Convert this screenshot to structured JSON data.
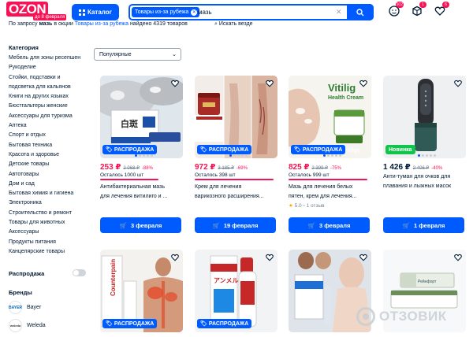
{
  "header": {
    "logo_text": "OZON",
    "logo_sub": "до 8 февраля",
    "catalog_label": "Каталог",
    "search_chip": "Товары из-за рубежа",
    "search_value": "мазь",
    "badges": {
      "messages": "102",
      "orders": "1",
      "favorites": "6"
    }
  },
  "results": {
    "prefix": "По запросу",
    "query": "мазь",
    "middle": "в окции",
    "scope": "Товары из-за рубежа",
    "suffix": "найдено 4319 товаров",
    "save_label": "Искать везде"
  },
  "sidebar": {
    "category_title": "Категория",
    "categories": [
      "Мебель для зоны ресепшен",
      "Рукоделие",
      "Стойки, подставки и",
      "подсветка для кальянов",
      "Книги на других языках",
      "Бюстгальтеры женские",
      "Аксессуары для туризма",
      "Аптека",
      "Спорт и отдых",
      "Бытовая техника",
      "Красота и здоровье",
      "Детские товары",
      "Автотовары",
      "Дом и сад",
      "Бытовая химия и гигиена",
      "Электроника",
      "Строительство и ремонт",
      "Товары для животных",
      "Аксессуары",
      "Продукты питания",
      "Канцелярские товары"
    ],
    "sale_label": "Распродажа",
    "brands_title": "Бренды",
    "brands": [
      {
        "name": "Bayer",
        "logo": "BAYER"
      },
      {
        "name": "Weleda",
        "logo": "weleda"
      }
    ]
  },
  "sort": {
    "selected": "Популярные"
  },
  "products": [
    {
      "tag": "РАСПРОДАЖА",
      "tag_type": "sale",
      "price": "253 ₽",
      "old": "2 068 ₽",
      "disc": "-88%",
      "left": "Осталось 1000 шт",
      "title1": "Антибактериальная мазь",
      "title2": "для лечения витилиго и ...",
      "rating": "",
      "reviews": "",
      "delivery": "3 февраля",
      "price_black": false
    },
    {
      "tag": "РАСПРОДАЖА",
      "tag_type": "sale",
      "price": "972 ₽",
      "old": "3 185 ₽",
      "disc": "-69%",
      "left": "Осталось 398 шт",
      "title1": "Крем для лечения",
      "title2": "варикозного расширения...",
      "rating": "",
      "reviews": "",
      "delivery": "19 февраля",
      "price_black": false
    },
    {
      "tag": "РАСПРОДАЖА",
      "tag_type": "sale",
      "price": "825 ₽",
      "old": "2 399 ₽",
      "disc": "-75%",
      "left": "Осталось 999 шт",
      "title1": "Мазь для лечения белых",
      "title2": "пятен, крем для лечения...",
      "rating": "5.0",
      "reviews": "1 отзыв",
      "delivery": "3 февраля",
      "price_black": false
    },
    {
      "tag": "Новинка",
      "tag_type": "new",
      "price": "1 426 ₽",
      "old": "2 406 ₽",
      "disc": "-40%",
      "left": "",
      "title1": "Анти-туман для очков для",
      "title2": "плавания и лыжных масок",
      "rating": "",
      "reviews": "",
      "delivery": "1 февраля",
      "price_black": true
    },
    {
      "tag": "РАСПРОДАЖА",
      "tag_type": "sale"
    },
    {
      "tag": "РАСПРОДАЖА",
      "tag_type": "sale"
    },
    {
      "tag": "",
      "tag_type": ""
    },
    {
      "tag": "",
      "tag_type": ""
    }
  ],
  "image_text": {
    "p1_box": "白斑",
    "p3_brand": "Vitilig",
    "p3_sub": "Health Cream",
    "p3_tag": "Vitiligo",
    "p5_brand": "Counterpain",
    "p6_brand": "アンメルツ",
    "p8_tube": "Рейнфорт"
  },
  "watermark": "ОТЗОВИК",
  "colors": {
    "accent": "#005bff",
    "sale": "#f91155",
    "new": "#10c44c"
  }
}
